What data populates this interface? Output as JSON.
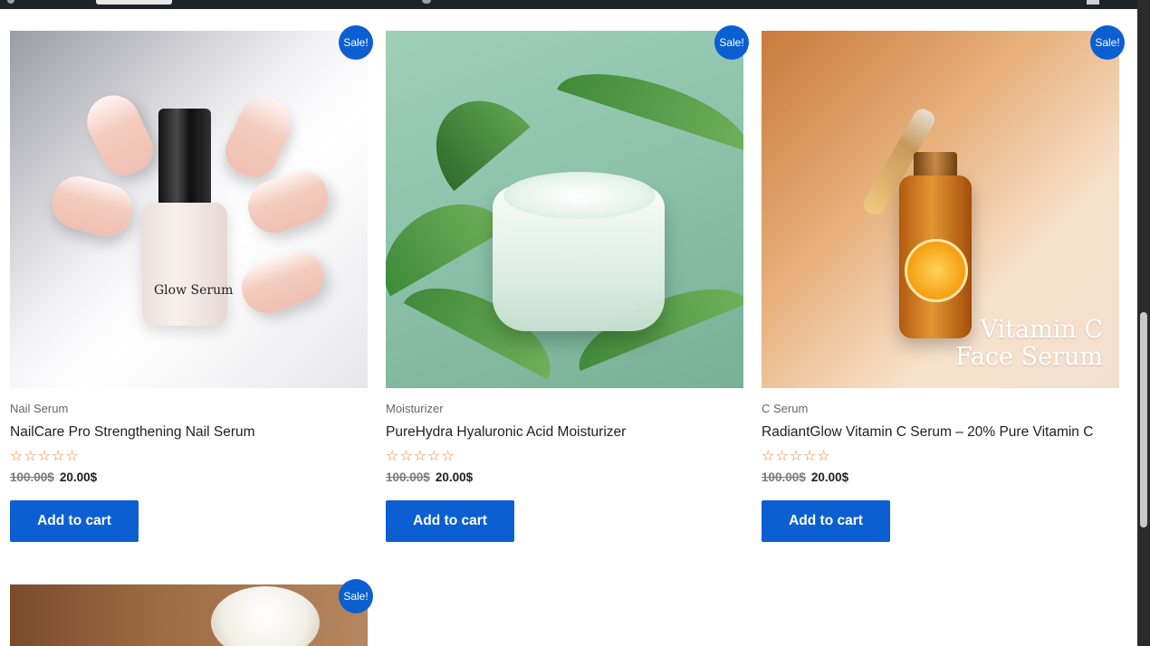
{
  "sale_badge": "Sale!",
  "products": [
    {
      "category": "Nail Serum",
      "title": "NailCare Pro Strengthening Nail Serum",
      "rating_stars": "☆☆☆☆☆",
      "old_price": "100.00$",
      "price": "20.00$",
      "button": "Add to cart",
      "image_label": "Glow Serum"
    },
    {
      "category": "Moisturizer",
      "title": "PureHydra Hyaluronic Acid Moisturizer",
      "rating_stars": "☆☆☆☆☆",
      "old_price": "100.00$",
      "price": "20.00$",
      "button": "Add to cart"
    },
    {
      "category": "C Serum",
      "title": "RadiantGlow Vitamin C Serum – 20% Pure Vitamin C",
      "rating_stars": "☆☆☆☆☆",
      "old_price": "100.00$",
      "price": "20.00$",
      "button": "Add to cart",
      "image_label_line1": "Vitamin C",
      "image_label_line2": "Face Serum"
    }
  ],
  "colors": {
    "accent": "#0b5fd1",
    "star": "#d98a3c",
    "admin_bar": "#1d2327"
  }
}
